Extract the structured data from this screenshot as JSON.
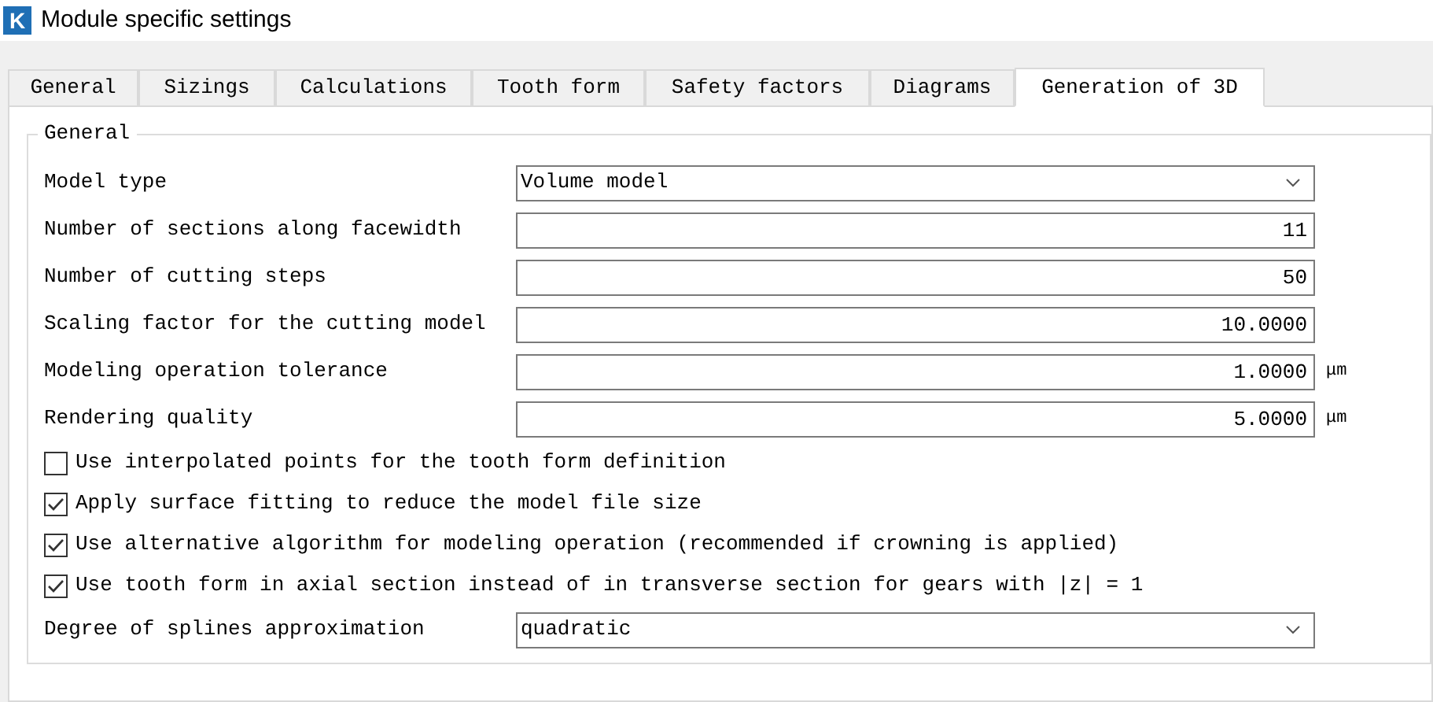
{
  "window": {
    "title": "Module specific settings",
    "logo": "K"
  },
  "tabs": [
    {
      "label": "General",
      "selected": false
    },
    {
      "label": "Sizings",
      "selected": false
    },
    {
      "label": "Calculations",
      "selected": false
    },
    {
      "label": "Tooth form",
      "selected": false
    },
    {
      "label": "Safety factors",
      "selected": false
    },
    {
      "label": "Diagrams",
      "selected": false
    },
    {
      "label": "Generation of 3D",
      "selected": true
    }
  ],
  "group": {
    "title": "General",
    "rows": [
      {
        "kind": "select",
        "label": "Model type",
        "value": "Volume model"
      },
      {
        "kind": "number",
        "label": "Number of sections along facewidth",
        "value": "11"
      },
      {
        "kind": "number",
        "label": "Number of cutting steps",
        "value": "50"
      },
      {
        "kind": "number",
        "label": "Scaling factor for the cutting model",
        "value": "10.0000"
      },
      {
        "kind": "number",
        "label": "Modeling operation tolerance",
        "value": "1.0000",
        "unit": "μm"
      },
      {
        "kind": "number",
        "label": "Rendering quality",
        "value": "5.0000",
        "unit": "μm"
      },
      {
        "kind": "checkbox",
        "label": "Use interpolated points for the tooth form definition",
        "checked": false
      },
      {
        "kind": "checkbox",
        "label": "Apply surface fitting to reduce the model file size",
        "checked": true
      },
      {
        "kind": "checkbox",
        "label": "Use alternative algorithm for modeling operation (recommended if crowning is applied)",
        "checked": true
      },
      {
        "kind": "checkbox",
        "label": "Use tooth form in axial section instead of in transverse section for gears with |z| = 1",
        "checked": true
      },
      {
        "kind": "select",
        "label": "Degree of splines approximation",
        "value": "quadratic"
      }
    ]
  }
}
